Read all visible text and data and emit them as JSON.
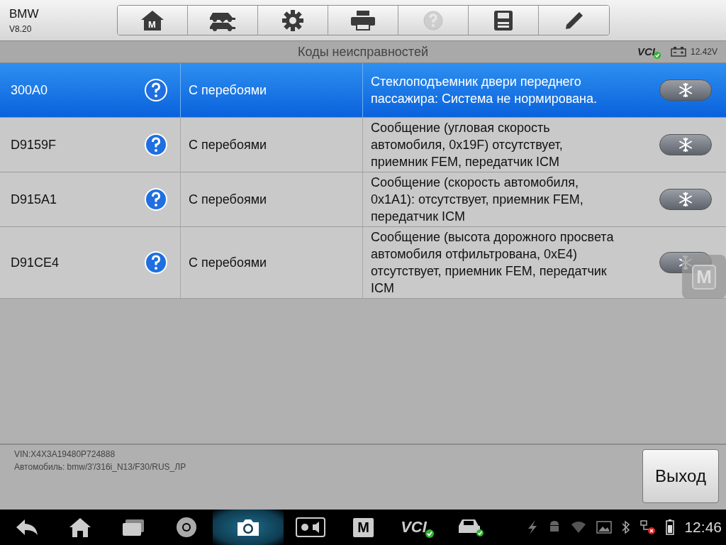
{
  "app": {
    "name": "BMW",
    "version": "V8.20"
  },
  "toolbar": [
    {
      "kind": "home",
      "label": "M",
      "disabled": false
    },
    {
      "kind": "cars",
      "disabled": false
    },
    {
      "kind": "gear",
      "disabled": false
    },
    {
      "kind": "printer",
      "disabled": false
    },
    {
      "kind": "help",
      "disabled": true
    },
    {
      "kind": "save",
      "disabled": false
    },
    {
      "kind": "pen",
      "disabled": false
    }
  ],
  "title": "Коды неисправностей",
  "status": {
    "vci": "VCI",
    "vci_connected": true,
    "voltage": "12.42V"
  },
  "faults": [
    {
      "code": "300A0",
      "status": "С перебоями",
      "description": "Стеклоподъемник двери переднего пассажира: Система не нормирована.",
      "selected": true
    },
    {
      "code": "D9159F",
      "status": "С перебоями",
      "description": "Сообщение (угловая скорость автомобиля, 0x19F) отсутствует, приемник FEM, передатчик ICM",
      "selected": false
    },
    {
      "code": "D915A1",
      "status": "С перебоями",
      "description": "Сообщение (скорость автомобиля, 0x1A1): отсутствует, приемник FEM, передатчик ICM",
      "selected": false
    },
    {
      "code": "D91CE4",
      "status": "С перебоями",
      "description": "Сообщение (высота дорожного просвета автомобиля отфильтрована, 0xE4) отсутствует, приемник FEM, передатчик ICM",
      "selected": false
    }
  ],
  "floating_button": {
    "label": "M"
  },
  "footer": {
    "vin": "VIN:X4X3A19480P724888",
    "vehicle": "Автомобиль: bmw/3'/316i_N13/F30/RUS_ЛР",
    "exit_button": "Выход"
  },
  "navbar": {
    "items": [
      {
        "kind": "back",
        "selected": false
      },
      {
        "kind": "home",
        "selected": false
      },
      {
        "kind": "recent",
        "selected": false
      },
      {
        "kind": "browser",
        "selected": false
      },
      {
        "kind": "camera",
        "selected": true
      },
      {
        "kind": "display",
        "selected": false
      },
      {
        "kind": "m-app",
        "label": "M",
        "selected": false
      },
      {
        "kind": "vci",
        "label": "VCI",
        "selected": false
      },
      {
        "kind": "car",
        "selected": false
      }
    ],
    "status_icons": [
      {
        "kind": "flash"
      },
      {
        "kind": "android"
      },
      {
        "kind": "wifi"
      },
      {
        "kind": "gallery"
      },
      {
        "kind": "bluetooth"
      },
      {
        "kind": "network-error"
      },
      {
        "kind": "battery"
      }
    ],
    "time": "12:46"
  }
}
